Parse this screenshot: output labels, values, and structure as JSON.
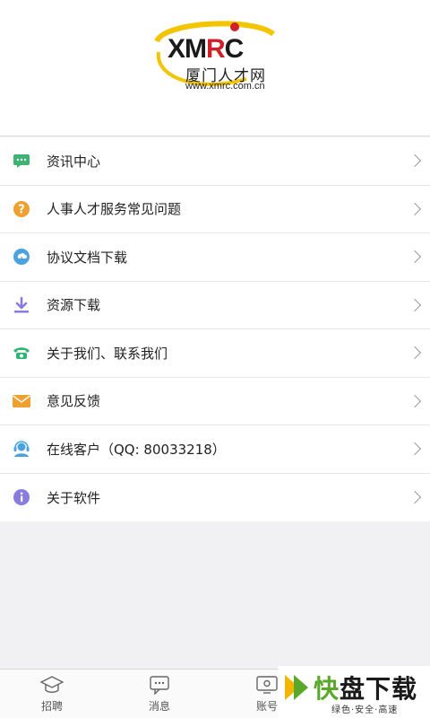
{
  "header": {
    "logo_text_left": "XM",
    "logo_text_r": "R",
    "logo_text_right": "C",
    "logo_cn": "厦门人才网",
    "logo_url": "www.xmrc.com.cn"
  },
  "menu": {
    "items": [
      {
        "label": "资讯中心",
        "icon": "chat-bubble-icon",
        "color": "#3cb371"
      },
      {
        "label": "人事人才服务常见问题",
        "icon": "question-icon",
        "color": "#f0a030"
      },
      {
        "label": "协议文档下载",
        "icon": "cloud-download-icon",
        "color": "#4aa3df"
      },
      {
        "label": "资源下载",
        "icon": "download-arrow-icon",
        "color": "#8a7be0"
      },
      {
        "label": "关于我们、联系我们",
        "icon": "phone-icon",
        "color": "#2bb673"
      },
      {
        "label": "意见反馈",
        "icon": "envelope-icon",
        "color": "#f0a030"
      },
      {
        "label": "在线客户（QQ: 80033218）",
        "icon": "headset-icon",
        "color": "#4aa3df"
      },
      {
        "label": "关于软件",
        "icon": "info-icon",
        "color": "#8a7be0"
      }
    ]
  },
  "tabbar": {
    "tabs": [
      {
        "label": "招聘",
        "icon": "graduation-cap-icon"
      },
      {
        "label": "消息",
        "icon": "message-icon"
      },
      {
        "label": "账号",
        "icon": "monitor-icon"
      }
    ]
  },
  "watermark": {
    "main_fast": "快",
    "main_rest": "盘下载",
    "sub": "绿色·安全·高速"
  }
}
